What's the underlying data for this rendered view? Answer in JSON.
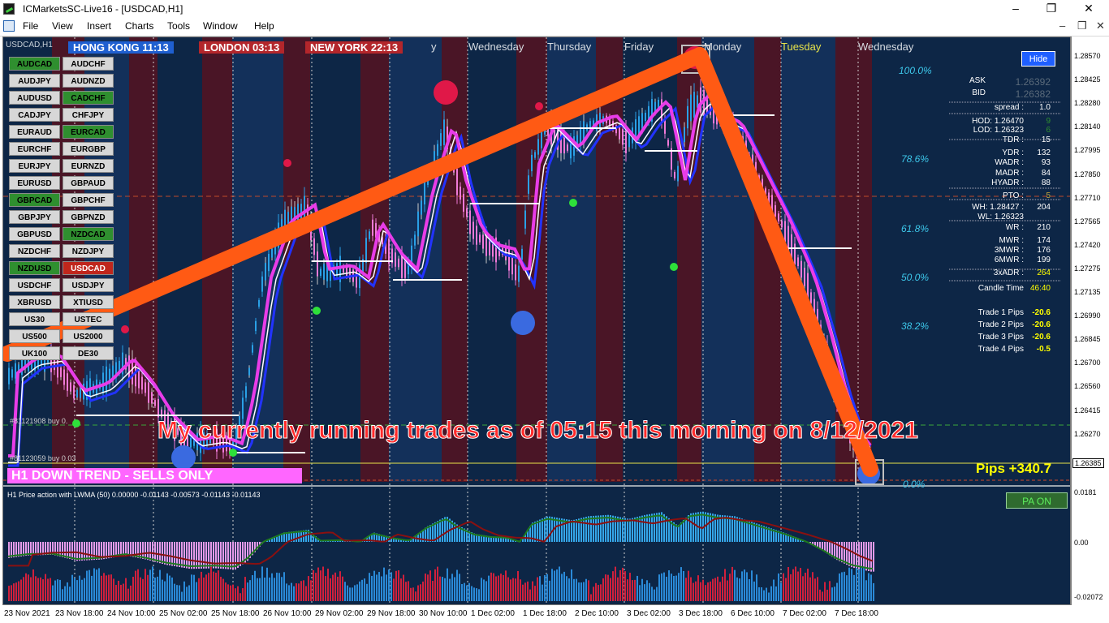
{
  "window": {
    "title": "ICMarketsSC-Live16 - [USDCAD,H1]",
    "controls": [
      "–",
      "❐",
      "✕"
    ]
  },
  "menu": [
    "File",
    "View",
    "Insert",
    "Charts",
    "Tools",
    "Window",
    "Help"
  ],
  "chart": {
    "symbol_label": "USDCAD,H1",
    "sessions": [
      {
        "label": "HONG KONG 11:13",
        "color": "#1f5fd0"
      },
      {
        "label": "LONDON  03:13",
        "color": "#b3262b"
      },
      {
        "label": "NEW YORK  22:13",
        "color": "#b3262b"
      }
    ],
    "day_labels": [
      {
        "text": "y",
        "color": "#d8dde3"
      },
      {
        "text": "Wednesday",
        "color": "#d8dde3"
      },
      {
        "text": "Thursday",
        "color": "#d8dde3"
      },
      {
        "text": "Friday",
        "color": "#d8dde3"
      },
      {
        "text": "Monday",
        "color": "#d8dde3"
      },
      {
        "text": "Tuesday",
        "color": "#e8e34a"
      },
      {
        "text": "Wednesday",
        "color": "#d8dde3"
      }
    ],
    "pairs": [
      {
        "label": "AUDCAD",
        "state": "green"
      },
      {
        "label": "AUDCHF",
        "state": "grey"
      },
      {
        "label": "AUDJPY",
        "state": "grey"
      },
      {
        "label": "AUDNZD",
        "state": "grey"
      },
      {
        "label": "AUDUSD",
        "state": "grey"
      },
      {
        "label": "CADCHF",
        "state": "green"
      },
      {
        "label": "CADJPY",
        "state": "grey"
      },
      {
        "label": "CHFJPY",
        "state": "grey"
      },
      {
        "label": "EURAUD",
        "state": "grey"
      },
      {
        "label": "EURCAD",
        "state": "green"
      },
      {
        "label": "EURCHF",
        "state": "grey"
      },
      {
        "label": "EURGBP",
        "state": "grey"
      },
      {
        "label": "EURJPY",
        "state": "grey"
      },
      {
        "label": "EURNZD",
        "state": "grey"
      },
      {
        "label": "EURUSD",
        "state": "grey"
      },
      {
        "label": "GBPAUD",
        "state": "grey"
      },
      {
        "label": "GBPCAD",
        "state": "green"
      },
      {
        "label": "GBPCHF",
        "state": "grey"
      },
      {
        "label": "GBPJPY",
        "state": "grey"
      },
      {
        "label": "GBPNZD",
        "state": "grey"
      },
      {
        "label": "GBPUSD",
        "state": "grey"
      },
      {
        "label": "NZDCAD",
        "state": "green"
      },
      {
        "label": "NZDCHF",
        "state": "grey"
      },
      {
        "label": "NZDJPY",
        "state": "grey"
      },
      {
        "label": "NZDUSD",
        "state": "green"
      },
      {
        "label": "USDCAD",
        "state": "red"
      },
      {
        "label": "USDCHF",
        "state": "grey"
      },
      {
        "label": "USDJPY",
        "state": "grey"
      },
      {
        "label": "XBRUSD",
        "state": "grey"
      },
      {
        "label": "XTIUSD",
        "state": "grey"
      },
      {
        "label": "US30",
        "state": "grey"
      },
      {
        "label": "USTEC",
        "state": "grey"
      },
      {
        "label": "US500",
        "state": "grey"
      },
      {
        "label": "US2000",
        "state": "grey"
      },
      {
        "label": "UK100",
        "state": "grey"
      },
      {
        "label": "DE30",
        "state": "grey"
      }
    ],
    "fib_levels": [
      "100.0%",
      "78.6%",
      "61.8%",
      "50.0%",
      "38.2%",
      "0.0%"
    ],
    "hide_button": "Hide",
    "stats": [
      {
        "label": "ASK",
        "value": "1.26392"
      },
      {
        "label": "BID",
        "value": "1.26382"
      },
      {
        "label": "spread :",
        "value": "1.0"
      },
      {
        "label": "HOD: 1.26470",
        "value": "9"
      },
      {
        "label": "LOD: 1.26323",
        "value": "6"
      },
      {
        "label": "TDR :",
        "value": "15"
      },
      {
        "label": "YDR :",
        "value": "132"
      },
      {
        "label": "WADR :",
        "value": "93"
      },
      {
        "label": "MADR :",
        "value": "84"
      },
      {
        "label": "HYADR :",
        "value": "88"
      },
      {
        "label": "PTO :",
        "value": "5"
      },
      {
        "label": "WH: 1.28427 :",
        "value": "204"
      },
      {
        "label": "WL: 1.26323",
        "value": ""
      },
      {
        "label": "WR :",
        "value": "210"
      },
      {
        "label": "MWR :",
        "value": "174"
      },
      {
        "label": "3MWR :",
        "value": "176"
      },
      {
        "label": "6MWR :",
        "value": "199"
      },
      {
        "label": "3xADR :",
        "value": "264"
      },
      {
        "label": "Candle Time",
        "value": "46:40"
      },
      {
        "label": "Trade 1 Pips",
        "value": "-20.6"
      },
      {
        "label": "Trade 2 Pips",
        "value": "-20.6"
      },
      {
        "label": "Trade 3 Pips",
        "value": "-20.6"
      },
      {
        "label": "Trade 4 Pips",
        "value": "-0.5"
      }
    ],
    "overlay_text": "My currently running trades as of 05:15 this morning on 8/12/2021",
    "trend_banner": "H1  DOWN TREND - SELLS ONLY",
    "pips_total": "Pips +340.7",
    "orders": [
      "#81121908 buy 0.",
      "#81123059 buy 0.03"
    ],
    "indicator_label": "H1 Price action with LWMA (50) 0.00000 -0.01143 -0.00573 -0.01143 -0.01143",
    "pa_button": "PA ON",
    "price_axis": [
      "1.28570",
      "1.28425",
      "1.28280",
      "1.28140",
      "1.27995",
      "1.27850",
      "1.27710",
      "1.27565",
      "1.27420",
      "1.27275",
      "1.27135",
      "1.26990",
      "1.26845",
      "1.26700",
      "1.26560",
      "1.26415",
      "1.26270"
    ],
    "price_current": "1.26385",
    "indicator_axis": [
      "0.0181",
      "0.00",
      "-0.02072"
    ],
    "time_axis": [
      "23 Nov 2021",
      "23 Nov 18:00",
      "24 Nov 10:00",
      "25 Nov 02:00",
      "25 Nov 18:00",
      "26 Nov 10:00",
      "29 Nov 02:00",
      "29 Nov 18:00",
      "30 Nov 10:00",
      "1 Dec 02:00",
      "1 Dec 18:00",
      "2 Dec 10:00",
      "3 Dec 02:00",
      "3 Dec 18:00",
      "6 Dec 10:00",
      "7 Dec 02:00",
      "7 Dec 18:00"
    ]
  }
}
